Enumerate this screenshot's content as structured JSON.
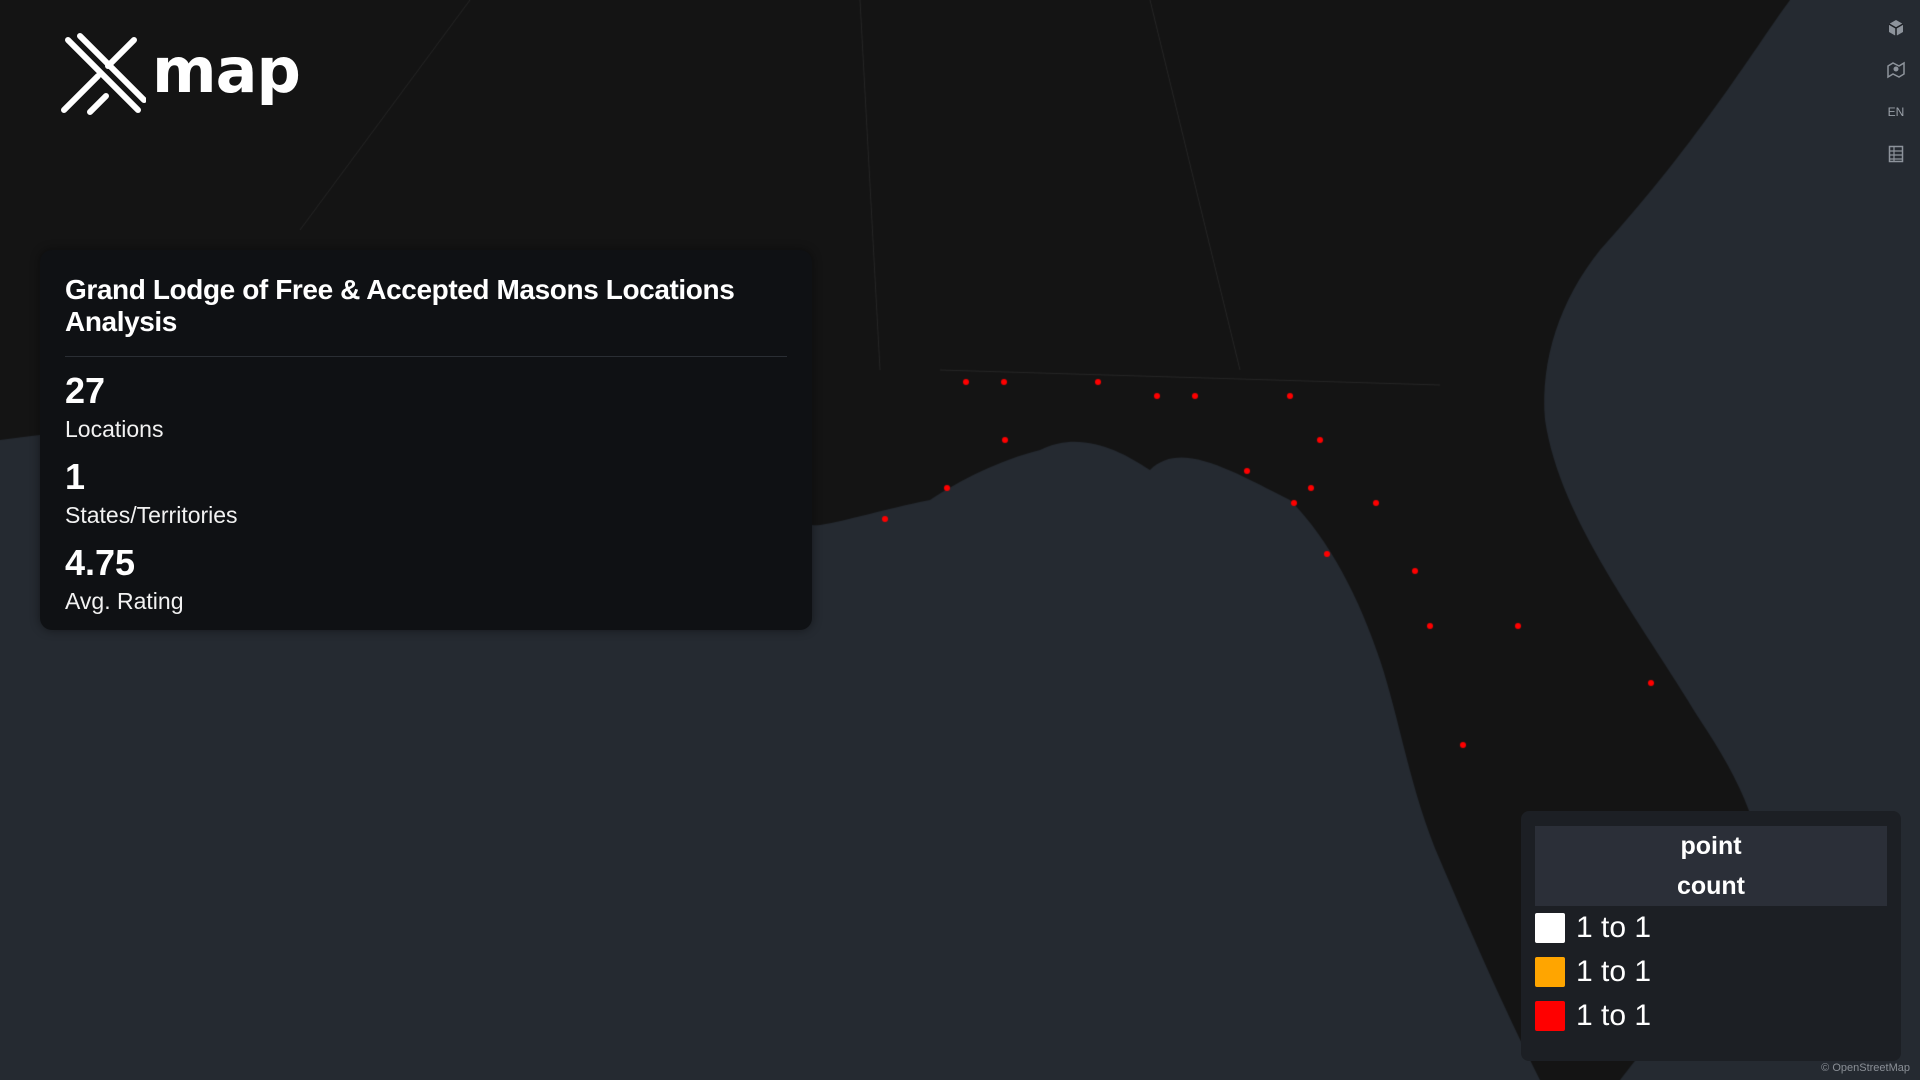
{
  "brand": {
    "logo_text": "map"
  },
  "stats": {
    "title": "Grand Lodge of Free & Accepted Masons Locations Analysis",
    "locations_value": "27",
    "locations_label": "Locations",
    "states_value": "1",
    "states_label": "States/Territories",
    "rating_value": "4.75",
    "rating_label": "Avg. Rating"
  },
  "legend": {
    "title_line1": "point",
    "title_line2": "count",
    "items": [
      {
        "label": "1 to 1",
        "color": "#ffffff"
      },
      {
        "label": "1 to 1",
        "color": "#ffa500"
      },
      {
        "label": "1 to 1",
        "color": "#ff0000"
      }
    ]
  },
  "controls": {
    "language": "EN",
    "icons": [
      "cube-icon",
      "map-style-icon",
      "language-icon",
      "table-icon"
    ]
  },
  "attribution": "© OpenStreetMap",
  "map": {
    "land_color": "#141414",
    "water_color": "#252a31",
    "point_color": "#ff0000"
  }
}
